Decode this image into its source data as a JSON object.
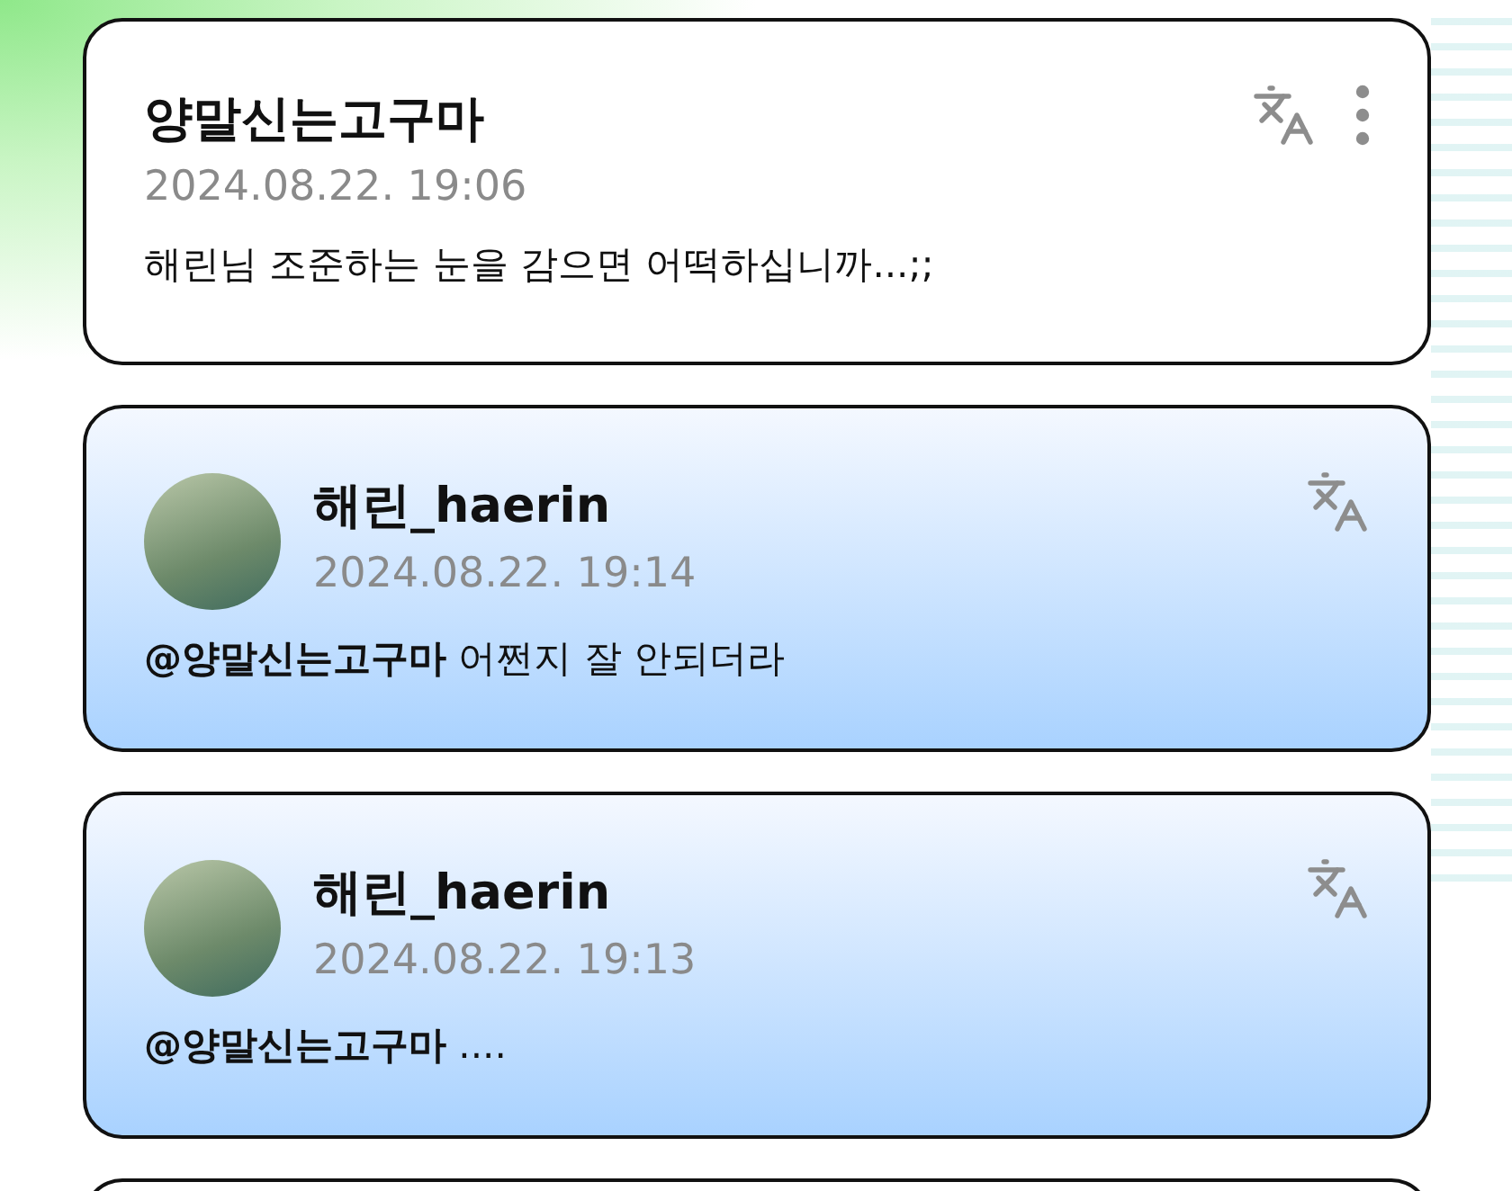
{
  "comments": [
    {
      "kind": "fan",
      "author": "양말신는고구마",
      "time": "2024.08.22. 19:06",
      "text": "해린님 조준하는 눈을 감으면 어떡하십니까...;;"
    },
    {
      "kind": "artist",
      "author": "해린_haerin",
      "time": "2024.08.22. 19:14",
      "text": "**@양말신는고구마** 어쩐지 잘 안되더라"
    },
    {
      "kind": "artist",
      "author": "해린_haerin",
      "time": "2024.08.22. 19:13",
      "text": "**@양말신는고구마** ...."
    }
  ]
}
